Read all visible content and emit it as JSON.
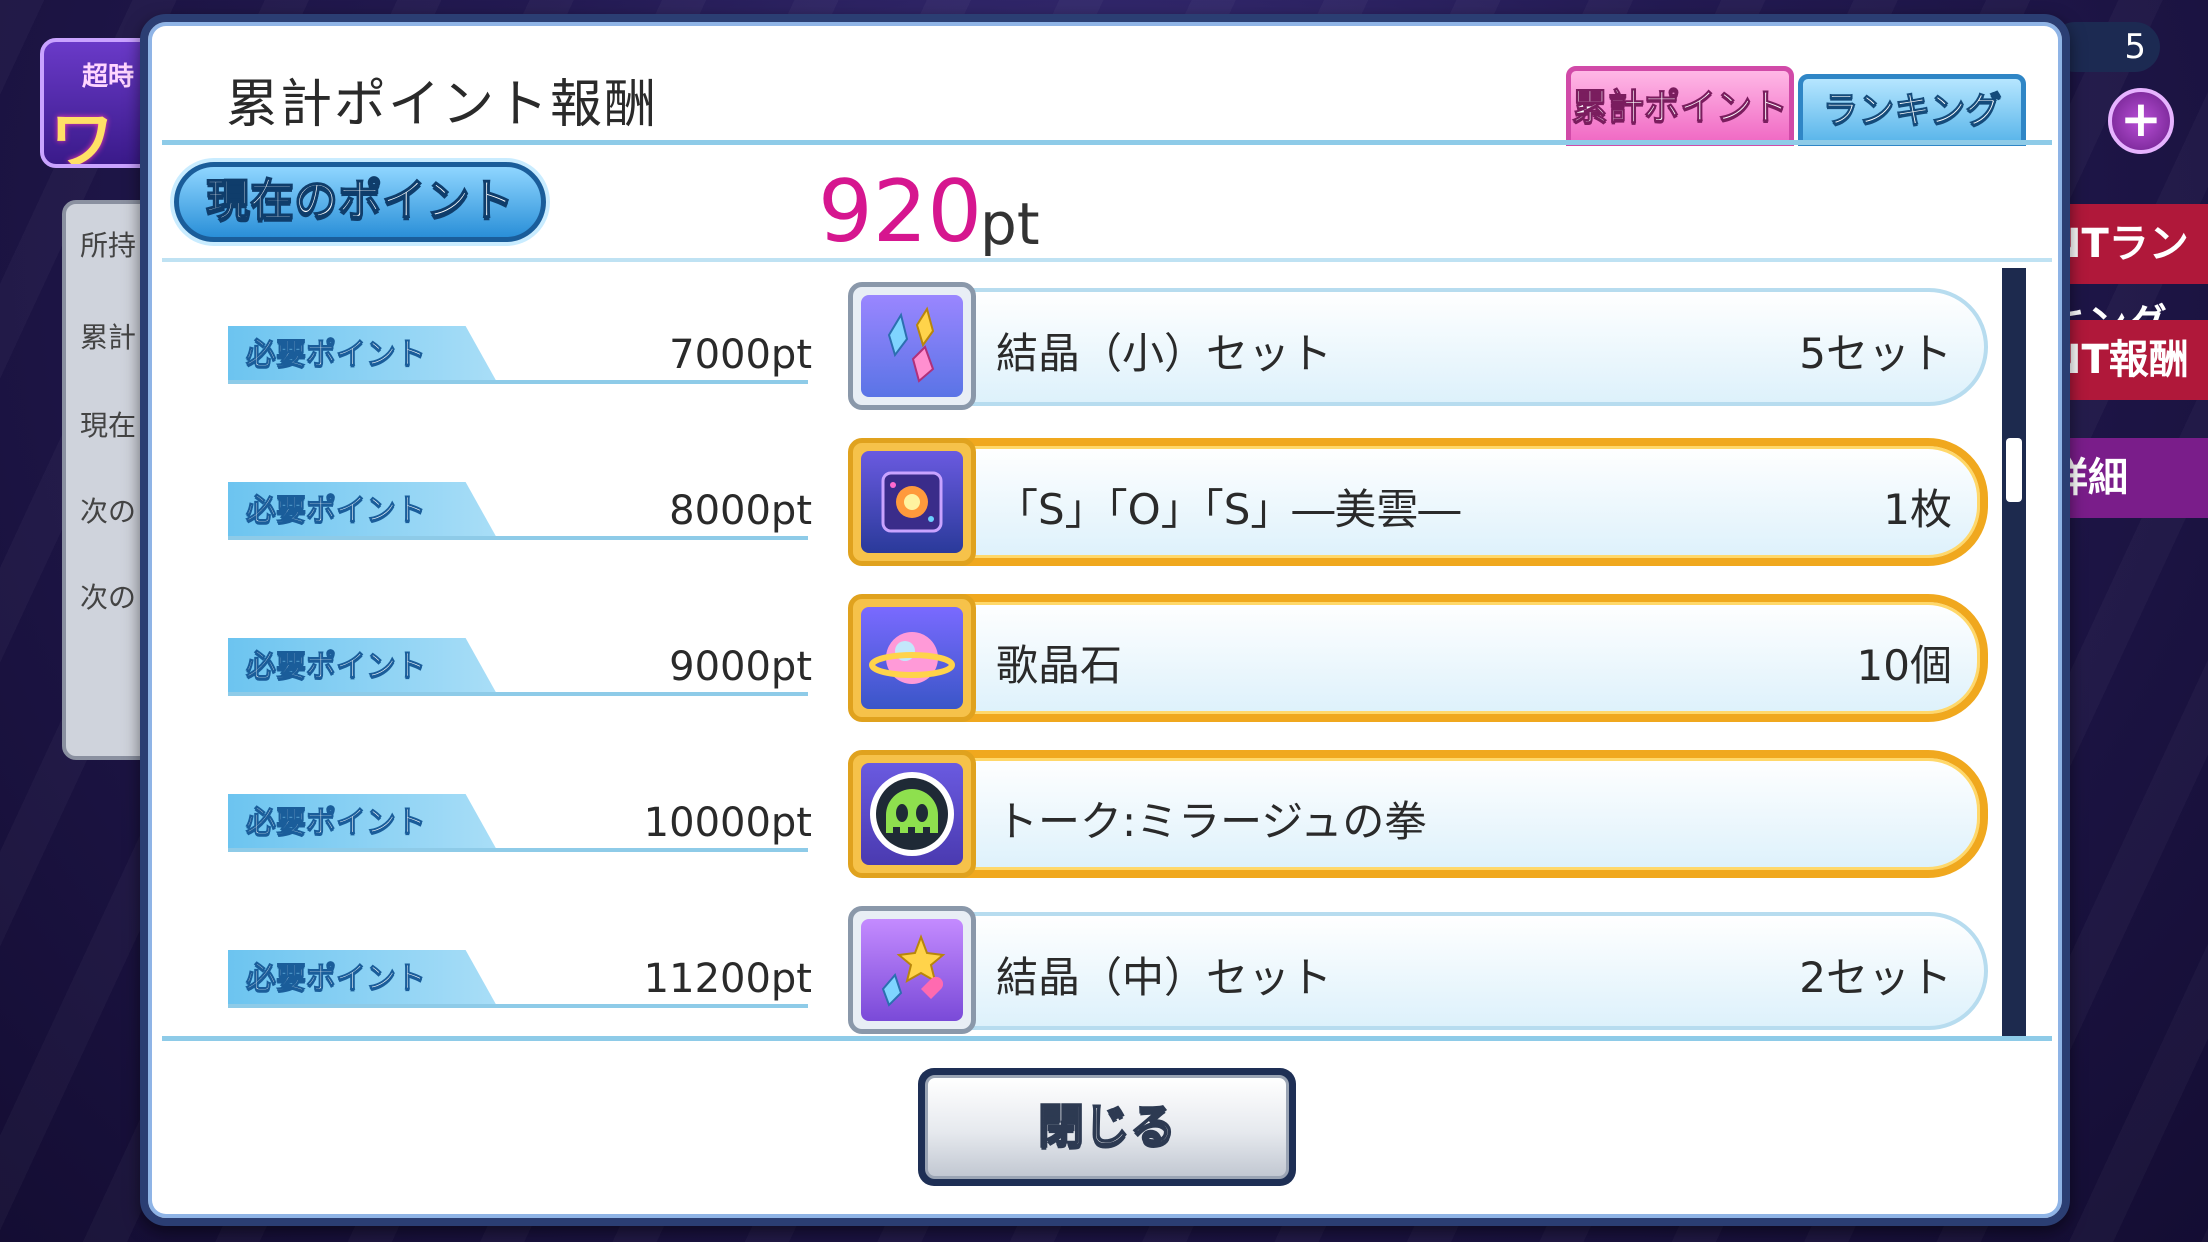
{
  "background": {
    "event_logo_line1": "超時",
    "event_logo_line2": "ワル",
    "side_panel_labels": [
      "所持",
      "累計",
      "現在",
      "次の",
      "次の"
    ],
    "right_pills": [
      "NTランキング",
      "NT報酬",
      "詳細"
    ],
    "counter_text": "5"
  },
  "dialog": {
    "title": "累計ポイント報酬",
    "tabs": [
      {
        "label": "累計ポイント",
        "active": true
      },
      {
        "label": "ランキング",
        "active": false
      }
    ],
    "current_points": {
      "label": "現在のポイント",
      "value": "920",
      "unit": "pt"
    },
    "rewards": [
      {
        "required_label": "必要ポイント",
        "required": "7000pt",
        "item": "結晶（小）セット",
        "quantity": "5セット",
        "highlight": false,
        "icon": "crystal-small-set-icon"
      },
      {
        "required_label": "必要ポイント",
        "required": "8000pt",
        "item": "「S」「O」「S」―美雲―",
        "quantity": "1枚",
        "highlight": true,
        "icon": "card-cube-icon"
      },
      {
        "required_label": "必要ポイント",
        "required": "9000pt",
        "item": "歌晶石",
        "quantity": "10個",
        "highlight": true,
        "icon": "song-crystal-planet-icon"
      },
      {
        "required_label": "必要ポイント",
        "required": "10000pt",
        "item": "トーク:ミラージュの拳",
        "quantity": "",
        "highlight": true,
        "icon": "talk-skull-icon"
      },
      {
        "required_label": "必要ポイント",
        "required": "11200pt",
        "item": "結晶（中）セット",
        "quantity": "2セット",
        "highlight": false,
        "icon": "crystal-medium-set-icon"
      }
    ],
    "close_label": "閉じる"
  },
  "colors": {
    "points_value": "#d6168f",
    "active_tab": "#f06ac4",
    "inactive_tab": "#5bb6ea",
    "highlight_border": "#f0a81e",
    "frame": "#2b3e73"
  }
}
